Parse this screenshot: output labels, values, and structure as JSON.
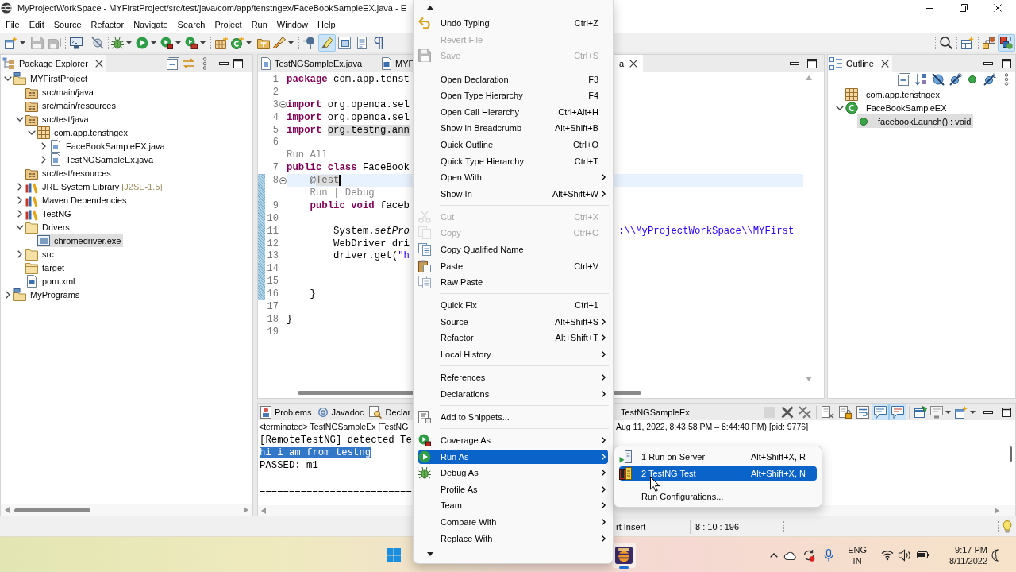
{
  "window": {
    "title": "MyProjectWorkSpace - MYFirstProject/src/test/java/com/app/tenstngex/FaceBookSampleEX.java - E"
  },
  "menu_bar": [
    "File",
    "Edit",
    "Source",
    "Refactor",
    "Navigate",
    "Search",
    "Project",
    "Run",
    "Window",
    "Help"
  ],
  "toolbar": {
    "groups": [
      [
        {
          "kind": "new",
          "dropdown": true,
          "on": false,
          "disabled": false
        },
        {
          "kind": "save",
          "on": false,
          "disabled": true
        },
        {
          "kind": "save-all",
          "on": false,
          "disabled": true
        }
      ],
      [
        {
          "kind": "terminal",
          "on": false,
          "disabled": false
        }
      ],
      [
        {
          "kind": "skip-breakpoints",
          "on": false,
          "disabled": false
        }
      ],
      [
        {
          "kind": "debug",
          "dropdown": true,
          "on": false,
          "disabled": false
        },
        {
          "kind": "run",
          "dropdown": true,
          "on": false,
          "disabled": false
        },
        {
          "kind": "coverage",
          "dropdown": true,
          "on": false,
          "disabled": false
        },
        {
          "kind": "external-tools",
          "dropdown": true,
          "on": false,
          "disabled": false
        }
      ],
      [
        {
          "kind": "new-package",
          "on": false,
          "disabled": false
        },
        {
          "kind": "new-class",
          "dropdown": true,
          "on": false,
          "disabled": false
        },
        {
          "kind": "open-type",
          "on": false,
          "disabled": false
        },
        {
          "kind": "search",
          "dropdown": true,
          "on": false,
          "disabled": false
        }
      ],
      [
        {
          "kind": "annotation",
          "on": false,
          "disabled": false
        },
        {
          "kind": "mark-occurrences",
          "on": true,
          "disabled": false
        },
        {
          "kind": "block-selection",
          "on": false,
          "disabled": false
        },
        {
          "kind": "show-source",
          "on": false,
          "disabled": false
        },
        {
          "kind": "whitespace",
          "on": false,
          "disabled": false
        }
      ]
    ],
    "right_groups": [
      [
        {
          "kind": "find",
          "on": false,
          "disabled": false
        }
      ],
      [
        {
          "kind": "open-perspective",
          "on": false,
          "disabled": false
        }
      ],
      [
        {
          "kind": "perspective-ee",
          "on": false,
          "disabled": false
        },
        {
          "kind": "perspective-java",
          "on": true,
          "disabled": false
        }
      ]
    ]
  },
  "package_explorer": {
    "title": "Package Explorer",
    "tree": [
      {
        "label": "MYFirstProject",
        "kind": "project",
        "expanded": true,
        "selected": false,
        "children": [
          {
            "label": "src/main/java",
            "kind": "source-folder",
            "selected": false
          },
          {
            "label": "src/main/resources",
            "kind": "source-folder",
            "selected": false
          },
          {
            "label": "src/test/java",
            "kind": "source-folder",
            "expanded": true,
            "selected": false,
            "children": [
              {
                "label": "com.app.tenstngex",
                "kind": "package",
                "expanded": true,
                "selected": false,
                "children": [
                  {
                    "label": "FaceBookSampleEX.java",
                    "kind": "java",
                    "expanded": false,
                    "selected": false
                  },
                  {
                    "label": "TestNGSampleEx.java",
                    "kind": "java",
                    "expanded": false,
                    "selected": false
                  }
                ]
              }
            ]
          },
          {
            "label": "src/test/resources",
            "kind": "source-folder",
            "selected": false
          },
          {
            "label": "JRE System Library",
            "decoration": "[J2SE-1.5]",
            "kind": "library",
            "expanded": false,
            "selected": false
          },
          {
            "label": "Maven Dependencies",
            "kind": "library",
            "expanded": false,
            "selected": false
          },
          {
            "label": "TestNG",
            "kind": "library",
            "expanded": false,
            "selected": false
          },
          {
            "label": "Drivers",
            "kind": "folder",
            "expanded": true,
            "selected": false,
            "children": [
              {
                "label": "chromedriver.exe",
                "kind": "exe",
                "selected": true
              }
            ]
          },
          {
            "label": "src",
            "kind": "folder",
            "expanded": false,
            "selected": false
          },
          {
            "label": "target",
            "kind": "folder",
            "selected": false
          },
          {
            "label": "pom.xml",
            "kind": "xml",
            "selected": false
          }
        ]
      },
      {
        "label": "MyPrograms",
        "kind": "project",
        "expanded": false,
        "selected": false
      }
    ]
  },
  "editor": {
    "tabs": [
      {
        "label": "TestNGSampleEx.java",
        "kind": "java",
        "selected": false
      },
      {
        "label": "MYF",
        "kind": "xml",
        "selected": false
      },
      {
        "label": "a",
        "selected": true
      }
    ],
    "blocks": [
      {
        "range": false,
        "lines": [
          {
            "kind": "code",
            "number": "1",
            "fold": false,
            "current": false,
            "tokens": [
              {
                "kind": "keyword",
                "text": "package"
              },
              {
                "kind": "plain",
                "text": " com.app.tenst"
              }
            ]
          },
          {
            "kind": "code",
            "number": "2",
            "fold": false,
            "current": false
          },
          {
            "kind": "code",
            "number": "3",
            "fold": true,
            "current": false,
            "tokens": [
              {
                "kind": "keyword",
                "text": "import"
              },
              {
                "kind": "plain",
                "text": " org.openqa.sel"
              }
            ]
          },
          {
            "kind": "code",
            "number": "4",
            "fold": false,
            "current": false,
            "tokens": [
              {
                "kind": "keyword",
                "text": "import"
              },
              {
                "kind": "plain",
                "text": " org.openqa.sel"
              }
            ]
          },
          {
            "kind": "code",
            "number": "5",
            "fold": false,
            "current": false,
            "tokens": [
              {
                "kind": "keyword",
                "text": "import "
              },
              {
                "kind": "highlight",
                "text": "org.testng.ann"
              }
            ]
          },
          {
            "kind": "code",
            "number": "6",
            "fold": false,
            "current": false
          },
          {
            "kind": "mining",
            "text": "Run All"
          },
          {
            "kind": "code",
            "number": "7",
            "fold": false,
            "current": false,
            "tokens": [
              {
                "kind": "keyword",
                "text": "public class"
              },
              {
                "kind": "plain",
                "text": " FaceBook"
              }
            ]
          }
        ]
      },
      {
        "range": true,
        "lines": [
          {
            "kind": "code",
            "number": "8",
            "fold": true,
            "current": true,
            "tokens": [
              {
                "kind": "annotation",
                "text": "    @"
              },
              {
                "kind": "annotation-highlight",
                "text": "Test"
              }
            ]
          },
          {
            "kind": "mining",
            "text": "Run | Debug"
          },
          {
            "kind": "code",
            "number": "9",
            "fold": false,
            "current": false,
            "tokens": [
              {
                "kind": "keyword",
                "text": "    public void"
              },
              {
                "kind": "plain",
                "text": " faceb"
              }
            ]
          },
          {
            "kind": "code",
            "number": "10",
            "fold": false,
            "current": false
          },
          {
            "kind": "code",
            "number": "11",
            "fold": false,
            "current": false,
            "tokens": [
              {
                "kind": "plain",
                "text": "        System."
              },
              {
                "kind": "static-call",
                "text": "setPro"
              }
            ],
            "right_part": [
              {
                "kind": "string",
                "text": ":\\\\MyProjectWorkSpace\\\\MYFirst"
              }
            ]
          },
          {
            "kind": "code",
            "number": "12",
            "fold": false,
            "current": false,
            "tokens": [
              {
                "kind": "plain",
                "text": "        WebDriver dri"
              }
            ]
          },
          {
            "kind": "code",
            "number": "13",
            "fold": false,
            "current": false,
            "tokens": [
              {
                "kind": "plain",
                "text": "        driver.get("
              },
              {
                "kind": "string",
                "text": "\"h"
              }
            ]
          },
          {
            "kind": "code",
            "number": "14",
            "fold": false,
            "current": false
          },
          {
            "kind": "code",
            "number": "15",
            "fold": false,
            "current": false
          },
          {
            "kind": "code",
            "number": "16",
            "fold": false,
            "current": false,
            "tokens": [
              {
                "kind": "plain",
                "text": "    }"
              }
            ]
          }
        ]
      },
      {
        "range": false,
        "lines": [
          {
            "kind": "code",
            "number": "17",
            "fold": false,
            "current": false
          },
          {
            "kind": "code",
            "number": "18",
            "fold": false,
            "current": false,
            "tokens": [
              {
                "kind": "plain",
                "text": "}"
              }
            ]
          },
          {
            "kind": "code",
            "number": "19",
            "fold": false,
            "current": false
          }
        ]
      }
    ]
  },
  "outline": {
    "title": "Outline",
    "tree": [
      {
        "label": "com.app.tenstngex",
        "kind": "package",
        "selected": false
      },
      {
        "label": "FaceBookSampleEX",
        "kind": "class",
        "expanded": true,
        "selected": false,
        "children": [
          {
            "label": "facebookLaunch() : void",
            "kind": "method",
            "selected": true
          }
        ]
      }
    ]
  },
  "console": {
    "tabs": [
      {
        "label": "Problems",
        "kind": "problems",
        "selected": false
      },
      {
        "label": "Javadoc",
        "kind": "javadoc",
        "selected": false
      },
      {
        "label": "Declar",
        "kind": "declaration",
        "selected": false
      },
      {
        "label": "TestNGSampleEx",
        "selected": false
      }
    ],
    "toolbar": [
      [
        {
          "kind": "terminate",
          "on": false,
          "disabled": true
        },
        {
          "kind": "remove-launch",
          "on": false,
          "disabled": false
        },
        {
          "kind": "remove-all",
          "on": false,
          "disabled": false
        }
      ],
      [
        {
          "kind": "clear",
          "on": false,
          "disabled": false
        },
        {
          "kind": "scroll-lock",
          "on": false,
          "disabled": false
        },
        {
          "kind": "word-wrap",
          "on": false,
          "disabled": false
        },
        {
          "kind": "show-stdout",
          "on": true,
          "disabled": false
        },
        {
          "kind": "show-stderr",
          "on": true,
          "disabled": false
        }
      ],
      [
        {
          "kind": "pin",
          "on": false,
          "disabled": false
        },
        {
          "kind": "display-console",
          "dropdown": true,
          "on": false,
          "disabled": false
        },
        {
          "kind": "open-console",
          "dropdown": true,
          "on": false,
          "disabled": false
        }
      ]
    ],
    "description_left": "<terminated> TestNGSampleEx [TestNG",
    "description_right": "Aug 11, 2022, 8:43:58 PM – 8:44:40 PM) [pid: 9776]",
    "output": [
      {
        "text": "[RemoteTestNG] detected Te",
        "selected": false
      },
      {
        "text": "hi i am from testng",
        "selected": true
      },
      {
        "text": "PASSED: m1",
        "selected": false
      }
    ],
    "divider_text": "=========================="
  },
  "status_bar": {
    "insert_mode": "rt Insert",
    "position": "8 : 10 : 196"
  },
  "taskbar": {
    "apps": [
      {
        "kind": "start",
        "active": false
      },
      {
        "kind": "ide",
        "active": true
      }
    ],
    "language": "ENG",
    "region": "IN",
    "time": "9:17 PM",
    "date": "8/11/2022"
  },
  "context_menu": {
    "groups": [
      [
        {
          "label": "Undo Typing",
          "shortcut": "Ctrl+Z",
          "kind": "undo",
          "disabled": false,
          "selected": false,
          "submenu": false
        },
        {
          "label": "Revert File",
          "kind": "plain",
          "disabled": true,
          "selected": false,
          "submenu": false
        },
        {
          "label": "Save",
          "shortcut": "Ctrl+S",
          "kind": "save",
          "disabled": true,
          "selected": false,
          "submenu": false
        }
      ],
      [
        {
          "label": "Open Declaration",
          "shortcut": "F3",
          "kind": "plain",
          "disabled": false,
          "selected": false,
          "submenu": false
        },
        {
          "label": "Open Type Hierarchy",
          "shortcut": "F4",
          "kind": "plain",
          "disabled": false,
          "selected": false,
          "submenu": false
        },
        {
          "label": "Open Call Hierarchy",
          "shortcut": "Ctrl+Alt+H",
          "kind": "plain",
          "disabled": false,
          "selected": false,
          "submenu": false
        },
        {
          "label": "Show in Breadcrumb",
          "shortcut": "Alt+Shift+B",
          "kind": "plain",
          "disabled": false,
          "selected": false,
          "submenu": false
        },
        {
          "label": "Quick Outline",
          "shortcut": "Ctrl+O",
          "kind": "plain",
          "disabled": false,
          "selected": false,
          "submenu": false
        },
        {
          "label": "Quick Type Hierarchy",
          "shortcut": "Ctrl+T",
          "kind": "plain",
          "disabled": false,
          "selected": false,
          "submenu": false
        },
        {
          "label": "Open With",
          "kind": "plain",
          "disabled": false,
          "selected": false,
          "submenu": true
        },
        {
          "label": "Show In",
          "shortcut": "Alt+Shift+W",
          "kind": "plain",
          "disabled": false,
          "selected": false,
          "submenu": true
        }
      ],
      [
        {
          "label": "Cut",
          "shortcut": "Ctrl+X",
          "kind": "cut",
          "disabled": true,
          "selected": false,
          "submenu": false
        },
        {
          "label": "Copy",
          "shortcut": "Ctrl+C",
          "kind": "copy",
          "disabled": true,
          "selected": false,
          "submenu": false
        },
        {
          "label": "Copy Qualified Name",
          "kind": "copy-qualified",
          "disabled": false,
          "selected": false,
          "submenu": false
        },
        {
          "label": "Paste",
          "shortcut": "Ctrl+V",
          "kind": "paste",
          "disabled": false,
          "selected": false,
          "submenu": false
        },
        {
          "label": "Raw Paste",
          "kind": "raw-paste",
          "disabled": false,
          "selected": false,
          "submenu": false
        }
      ],
      [
        {
          "label": "Quick Fix",
          "shortcut": "Ctrl+1",
          "kind": "plain",
          "disabled": false,
          "selected": false,
          "submenu": false
        },
        {
          "label": "Source",
          "shortcut": "Alt+Shift+S",
          "kind": "plain",
          "disabled": false,
          "selected": false,
          "submenu": true
        },
        {
          "label": "Refactor",
          "shortcut": "Alt+Shift+T",
          "kind": "plain",
          "disabled": false,
          "selected": false,
          "submenu": true
        },
        {
          "label": "Local History",
          "kind": "plain",
          "disabled": false,
          "selected": false,
          "submenu": true
        }
      ],
      [
        {
          "label": "References",
          "kind": "plain",
          "disabled": false,
          "selected": false,
          "submenu": true
        },
        {
          "label": "Declarations",
          "kind": "plain",
          "disabled": false,
          "selected": false,
          "submenu": true
        }
      ],
      [
        {
          "label": "Add to Snippets...",
          "kind": "snippets",
          "disabled": false,
          "selected": false,
          "submenu": false
        }
      ],
      [
        {
          "label": "Coverage As",
          "kind": "coverage",
          "disabled": false,
          "selected": false,
          "submenu": true
        },
        {
          "label": "Run As",
          "kind": "run",
          "disabled": false,
          "selected": true,
          "submenu": true
        },
        {
          "label": "Debug As",
          "kind": "debug",
          "disabled": false,
          "selected": false,
          "submenu": true
        },
        {
          "label": "Profile As",
          "kind": "plain",
          "disabled": false,
          "selected": false,
          "submenu": true
        },
        {
          "label": "Team",
          "kind": "plain",
          "disabled": false,
          "selected": false,
          "submenu": true
        },
        {
          "label": "Compare With",
          "kind": "plain",
          "disabled": false,
          "selected": false,
          "submenu": true
        },
        {
          "label": "Replace With",
          "kind": "plain",
          "disabled": false,
          "selected": false,
          "submenu": true
        }
      ]
    ]
  },
  "run_as_submenu": {
    "groups": [
      [
        {
          "label": "1 Run on Server",
          "shortcut": "Alt+Shift+X, R",
          "kind": "server",
          "selected": false
        },
        {
          "label": "2 TestNG Test",
          "shortcut": "Alt+Shift+X, N",
          "kind": "testng",
          "selected": true
        }
      ],
      [
        {
          "label": "Run Configurations...",
          "kind": "plain",
          "selected": false
        }
      ]
    ]
  }
}
